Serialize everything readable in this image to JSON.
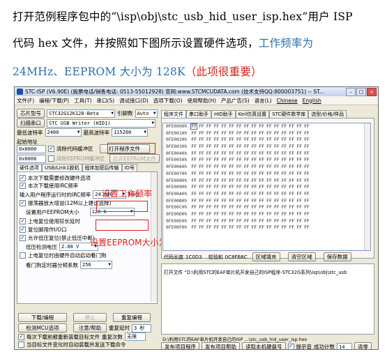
{
  "doc": {
    "p1": "打开范例程序包中的“\\isp\\obj\\stc_usb_hid_user_isp.hex”用户 ISP",
    "p2_black": "代码 hex 文件，并按照如下图所示设置硬件选项，",
    "p2_blue": "工作频率为",
    "p3_blue": "24MHz、EEPROM 大小为 128K",
    "p3_red": "（此项很重要）"
  },
  "window": {
    "title": "STC-ISP (V6.90E) (股票电话/销售电话: 0513-55012928) 官网:www.STCMCUDATA.com (技术支持QQ:800003751) -- ST...",
    "menu": [
      "文件(F)",
      "编程/下载(P)",
      "工具(T)",
      "串口(S)",
      "调试接口(D)",
      "选项下载(O)",
      "使用帮助(H)",
      "产品广告(S)",
      "语言(L)",
      "Chinese",
      "English"
    ]
  },
  "left": {
    "chip_label": "芯片型号",
    "chip_value": "STC32G12K128-Beta",
    "pin_label": "引脚数",
    "pin_value": "Auto",
    "scan_btn": "扫描串口",
    "port_value": "STC USB Writer (HID1)",
    "min_baud_label": "最低波特率",
    "min_baud": "2400",
    "max_baud_label": "最高波特率",
    "max_baud": "115200",
    "start_addr_label": "起始地址",
    "addr1": "0x0000",
    "clear_code": "清除代码缓冲区",
    "open_prog": "打开程序文件",
    "addr2": "0x0000",
    "clear_eeprom": "清除EEPROM缓冲区",
    "open_eeprom": "打开EEPROM文件",
    "tabs": [
      "硬件选项",
      "USB/Link1脱机",
      "程序加密后传输",
      "ID号"
    ],
    "opt1": "本次下载需要修改硬件选项",
    "opt2": "本次下载使用IRC频率",
    "freq_label": "输入用户程序运行时的IRC频率",
    "freq_value": "24.000",
    "freq_unit": "MHz",
    "opt3": "振荡器放大增益(12M以上建议选择)",
    "eeprom_label": "设置用户EEPROM大小",
    "eeprom_value": "128  K",
    "opt4": "上电复位使用较长延时",
    "opt5": "复位脚用作I/O口",
    "opt6": "允许低压复位(禁止低压中断)",
    "lvd_label": "低压检测电压",
    "lvd_value": "2.00 V",
    "opt7": "上电复位时由硬件自动启动看门狗",
    "wdt_label": "看门狗定时器分频系数",
    "wdt_value": "256",
    "download_btn": "下载/编程",
    "stop_btn": "停止",
    "reprog_btn": "重复编程",
    "detect_btn": "检测MCU选项",
    "help_btn": "注意/帮助",
    "delay_label": "重复延时",
    "delay_value": "3 秒",
    "count_label": "重复次数",
    "count_value": "无限",
    "reload1": "每次下载前都重新装载目标文件",
    "reload2": "当目标文件变化时自动装载并发送下载命令"
  },
  "annotations": {
    "freq": "设置工作频率",
    "eeprom": "设置EEPROM大小为128K"
  },
  "right": {
    "tabs": [
      "程序文件",
      "串口助手",
      "HID助手",
      "Keil仿真设置",
      "STC硬件数学库",
      "选型/价格/样品"
    ],
    "rows": [
      "0FE0000h",
      "0FE0010h",
      "0FE0020h",
      "0FE0030h",
      "0FE0040h",
      "0FE0050h",
      "0FE0060h",
      "0FE0070h",
      "0FE0080h",
      "0FE0090h",
      "0FE00A0h",
      "0FE00B0h",
      "0FE00C0h",
      "0FE00D0h",
      "0FE00E0h",
      "0FE00F0h"
    ],
    "byte": "FF",
    "code_len_label": "代码长度",
    "code_len": "1C0D3",
    "checksum_label": "校验和",
    "checksum": "0C8FB8C",
    "fill_btn": "区域填充",
    "clear_btn": "清空区域",
    "save_btn": "保存数据",
    "log_line": "打开文件 “D:\\利用STC的EAF单片机开发自己的ISP程序-STC32G系列\\isp\\obj\\stc_usb",
    "path_line": "D:\\利用STC的EAF单片机开发自己的ISP ...\\stc_usb_hid_user_isp.hex",
    "publish1": "发布项目程序",
    "publish2": "发布项目帮助",
    "read_serial": "读取本机硬盘号",
    "tone": "提示音",
    "success_label": "成功计数",
    "success_count": "14",
    "clear_count": "清零"
  }
}
